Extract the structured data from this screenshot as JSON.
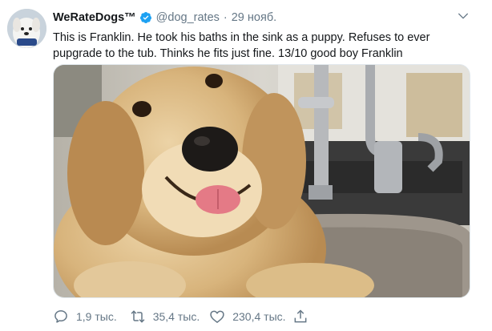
{
  "tweet": {
    "display_name": "WeRateDogs™",
    "handle": "@dog_rates",
    "separator": "·",
    "date": "29 нояб.",
    "text": "This is Franklin. He took his baths in the sink as a puppy. Refuses to ever pupgrade to the tub. Thinks he fits just fine. 13/10 good boy Franklin",
    "photo_subject": "golden retriever sitting in a kitchen sink"
  },
  "actions": {
    "replies": "1,9 тыс.",
    "retweets": "35,4 тыс.",
    "likes": "230,4 тыс."
  },
  "icons": {
    "verified": "verified-badge-icon",
    "caret": "chevron-down-icon",
    "reply": "reply-icon",
    "retweet": "retweet-icon",
    "like": "heart-icon",
    "share": "share-icon"
  },
  "colors": {
    "accent": "#1da1f2",
    "text": "#14171a",
    "secondary": "#657786"
  }
}
